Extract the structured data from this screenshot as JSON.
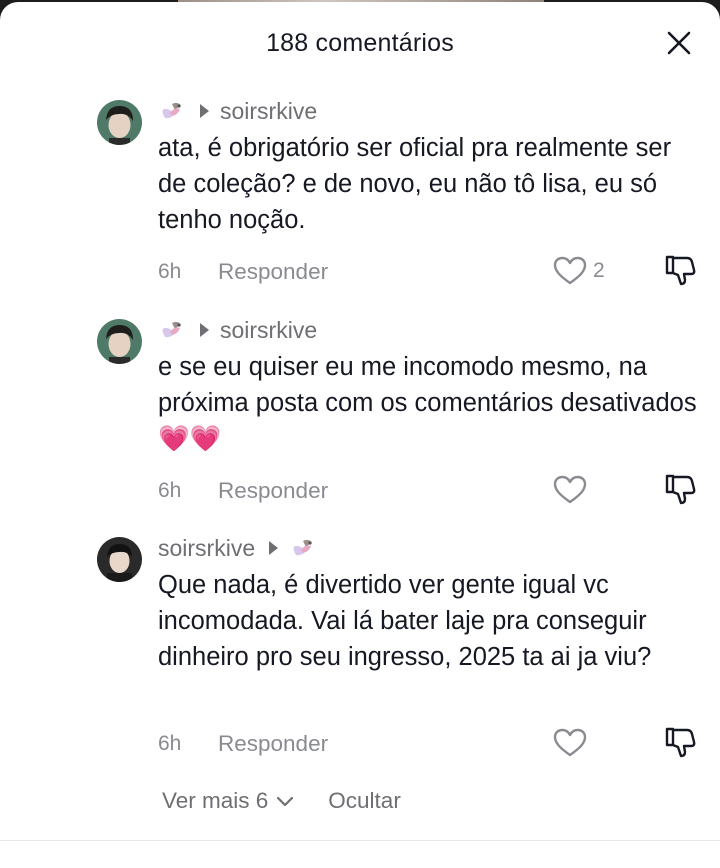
{
  "header": {
    "title": "188 comentários"
  },
  "comments": [
    {
      "username": "soirsrkive",
      "text": "ata, é obrigatório ser oficial pra realmente ser de coleção? e de novo, eu não tô lisa, eu só tenho noção.",
      "time": "6h",
      "reply_label": "Responder",
      "like_count": "2"
    },
    {
      "username": "soirsrkive",
      "text": "e se eu quiser eu me incomodo mesmo, na próxima posta com os comentários desativados 💗💗",
      "time": "6h",
      "reply_label": "Responder",
      "like_count": ""
    },
    {
      "username": "soirsrkive",
      "text": "Que nada, é divertido ver gente igual vc incomodada. Vai lá bater laje pra conseguir dinheiro pro seu ingresso, 2025 ta ai ja viu?",
      "time": "6h",
      "reply_label": "Responder",
      "like_count": ""
    }
  ],
  "footer": {
    "more_label": "Ver mais 6",
    "hide_label": "Ocultar"
  },
  "icons": {
    "close": "close-icon",
    "like": "heart-icon",
    "dislike": "thumbs-down-icon",
    "expand": "chevron-down-icon",
    "reply_arrow": "play-arrow-icon"
  }
}
